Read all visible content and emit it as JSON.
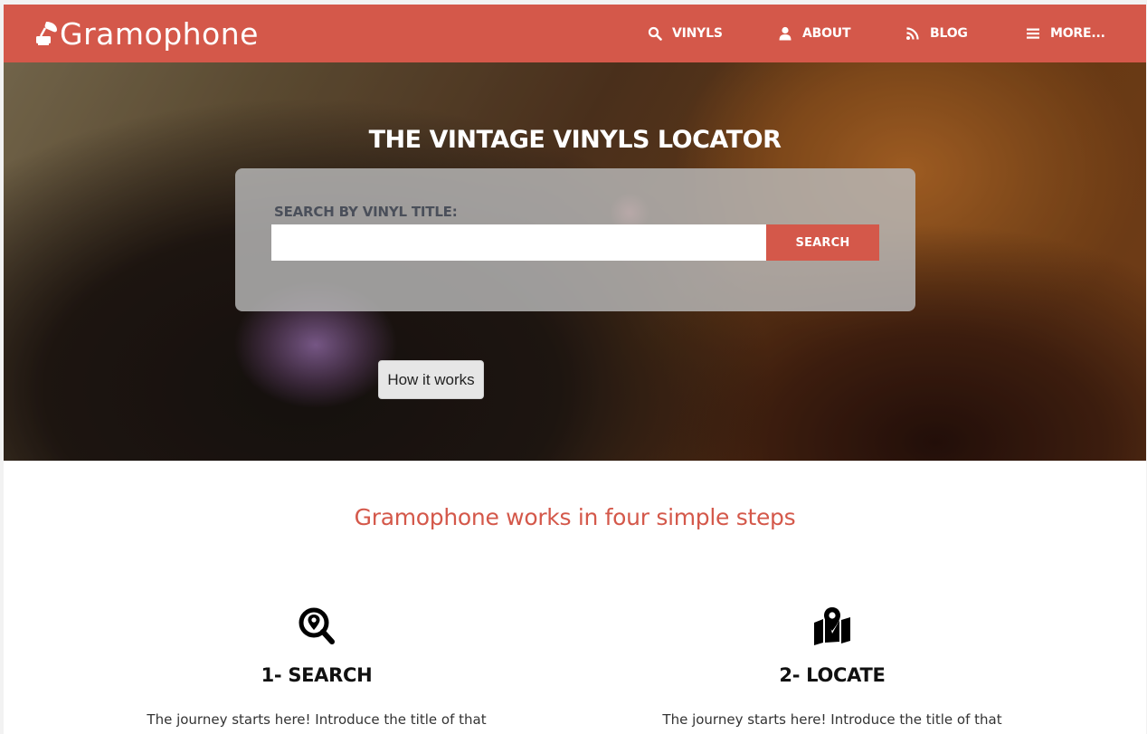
{
  "colors": {
    "brand": "#d4584a",
    "nav_text": "#ffffff",
    "heading_accent": "#d4584a",
    "search_label": "#4a4f5a"
  },
  "navbar": {
    "brand_name": "Gramophone",
    "brand_icon": "gramophone-icon",
    "items": [
      {
        "label": "VINYLS",
        "icon": "search-icon"
      },
      {
        "label": "ABOUT",
        "icon": "user-icon"
      },
      {
        "label": "BLOG",
        "icon": "rss-icon"
      },
      {
        "label": "MORE...",
        "icon": "menu-icon"
      }
    ]
  },
  "hero": {
    "title": "THE VINTAGE VINYLS LOCATOR",
    "search": {
      "label": "SEARCH BY VINYL TITLE:",
      "value": "",
      "button_label": "SEARCH"
    },
    "how_button_label": "How it works"
  },
  "steps": {
    "heading": "Gramophone works in four simple steps",
    "items": [
      {
        "icon": "search-location-icon",
        "title": "1- SEARCH",
        "text": "The journey starts here! Introduce the title of that"
      },
      {
        "icon": "map-marked-icon",
        "title": "2- LOCATE",
        "text": "The journey starts here! Introduce the title of that"
      }
    ]
  }
}
